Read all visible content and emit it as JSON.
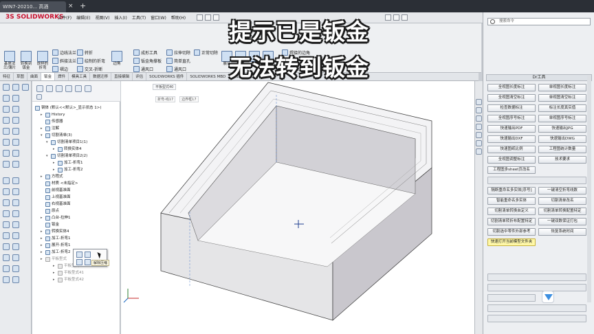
{
  "window": {
    "tab_title": "WIN7-20210... 高酒",
    "close_glyph": "×",
    "add_glyph": "+"
  },
  "app": {
    "logo": "3S SOLIDWORKS",
    "menus": [
      "文件(F)",
      "编辑(E)",
      "视图(V)",
      "插入(I)",
      "工具(T)",
      "窗口(W)",
      "帮助(H)"
    ]
  },
  "ribbon": {
    "large": [
      {
        "label": "基体法兰/薄片"
      },
      {
        "label": "转换到钣金"
      },
      {
        "label": "放样的折弯"
      }
    ],
    "small": [
      {
        "label": "边线法兰"
      },
      {
        "label": "斜接法兰"
      },
      {
        "label": "褶边"
      },
      {
        "label": "转折"
      },
      {
        "label": "绘制的折弯"
      },
      {
        "label": "交叉-折断"
      },
      {
        "label": "边角"
      },
      {
        "label": "成形工具"
      },
      {
        "label": "钣金角撑板"
      },
      {
        "label": "通风口"
      },
      {
        "label": "拉伸切除"
      },
      {
        "label": "简单直孔"
      },
      {
        "label": "通风口"
      },
      {
        "label": "正常切除"
      },
      {
        "label": "展开"
      },
      {
        "label": "折叠"
      },
      {
        "label": "扣"
      },
      {
        "label": "折弯"
      },
      {
        "label": "焊接的边角"
      },
      {
        "label": "切口"
      },
      {
        "label": "扫描法兰"
      }
    ]
  },
  "cm_tabs": [
    "特征",
    "草图",
    "曲面",
    "钣金",
    "焊件",
    "模具工具",
    "数据迁移",
    "直接编辑",
    "评估",
    "SOLIDWORKS 插件",
    "SOLIDWORKS MBD",
    "埔士钣金"
  ],
  "tree": {
    "rows": [
      {
        "text": "钢体 (默认<<默认>_显示状态 1>)",
        "grey": false
      },
      {
        "text": "History",
        "grey": false
      },
      {
        "text": "传感器",
        "grey": false
      },
      {
        "text": "注解",
        "grey": false
      },
      {
        "text": "切割清单(3)",
        "grey": false
      },
      {
        "text": "切割清单项目1(1)",
        "grey": false
      },
      {
        "text": "转换实体4",
        "grey": false
      },
      {
        "text": "切割清单项目2(2)",
        "grey": false
      },
      {
        "text": "加工-折弯1",
        "grey": false
      },
      {
        "text": "加工-折弯2",
        "grey": false
      },
      {
        "text": "方程式",
        "grey": false
      },
      {
        "text": "材质 <未指定>",
        "grey": false
      },
      {
        "text": "前视基准面",
        "grey": false
      },
      {
        "text": "上视基准面",
        "grey": false
      },
      {
        "text": "右视基准面",
        "grey": false
      },
      {
        "text": "原点",
        "grey": false
      },
      {
        "text": "凸台-拉伸1",
        "grey": false
      },
      {
        "text": "钣金",
        "grey": false
      },
      {
        "text": "转换实体4",
        "grey": false
      },
      {
        "text": "加工-折弯1",
        "grey": false
      },
      {
        "text": "展开-折弯1",
        "grey": false
      },
      {
        "text": "加工-折弯2",
        "grey": false
      },
      {
        "text": "平板型式",
        "grey": true
      },
      {
        "text": "平板型式40",
        "grey": true
      },
      {
        "text": "平板型式41",
        "grey": true
      },
      {
        "text": "平板型式42",
        "grey": true
      }
    ],
    "popup_tip": "解除压缩"
  },
  "viewport": {
    "headsup": "平板型式40",
    "breadcrumb": [
      "折弯-线17",
      "边界框17"
    ]
  },
  "overlay": {
    "line1": "提示已是钣金",
    "line2": "无法转到钣金"
  },
  "toolpanel": {
    "search_placeholder": "搜索命令",
    "header": "Dr工具",
    "grid_buttons": [
      [
        "全视图长度标注",
        "单视图长度标注"
      ],
      [
        "全视图清空标注",
        "单视图清空标注"
      ],
      [
        "检查数据标注",
        "标注长度真实值"
      ],
      [
        "全视图序号标注",
        "单视图序号标注"
      ],
      [
        "快速输出PDF",
        "快速输出JPG"
      ],
      [
        "快速输出DXF",
        "快速输出DWG"
      ],
      [
        "快速图纸比例",
        "工程图统计数量"
      ],
      [
        "全视图调整标注",
        "技术要求"
      ]
    ],
    "single_button": "工程图多sheet页改名",
    "grid_buttons2": [
      [
        "隔断重命名多实体[序号]",
        "一键清空折弯线数"
      ],
      [
        "智能重命名多实体",
        "切割清单改名"
      ],
      [
        "切割清单转换自定义",
        "切割清单转换配置特定"
      ],
      [
        "切割清单转折布配置特定",
        "一键双数保证打包"
      ],
      [
        "切割选中零件外部参考",
        "恢复系统时间"
      ]
    ],
    "highlight_button": "快速打开当前模型文件夹"
  },
  "colors": {
    "accent": "#3d8fe0",
    "overlay_text": "#ffffff",
    "box_front": "#e4e4e6",
    "box_top": "#f2f2f4",
    "box_inner": "#c8c6cd"
  }
}
